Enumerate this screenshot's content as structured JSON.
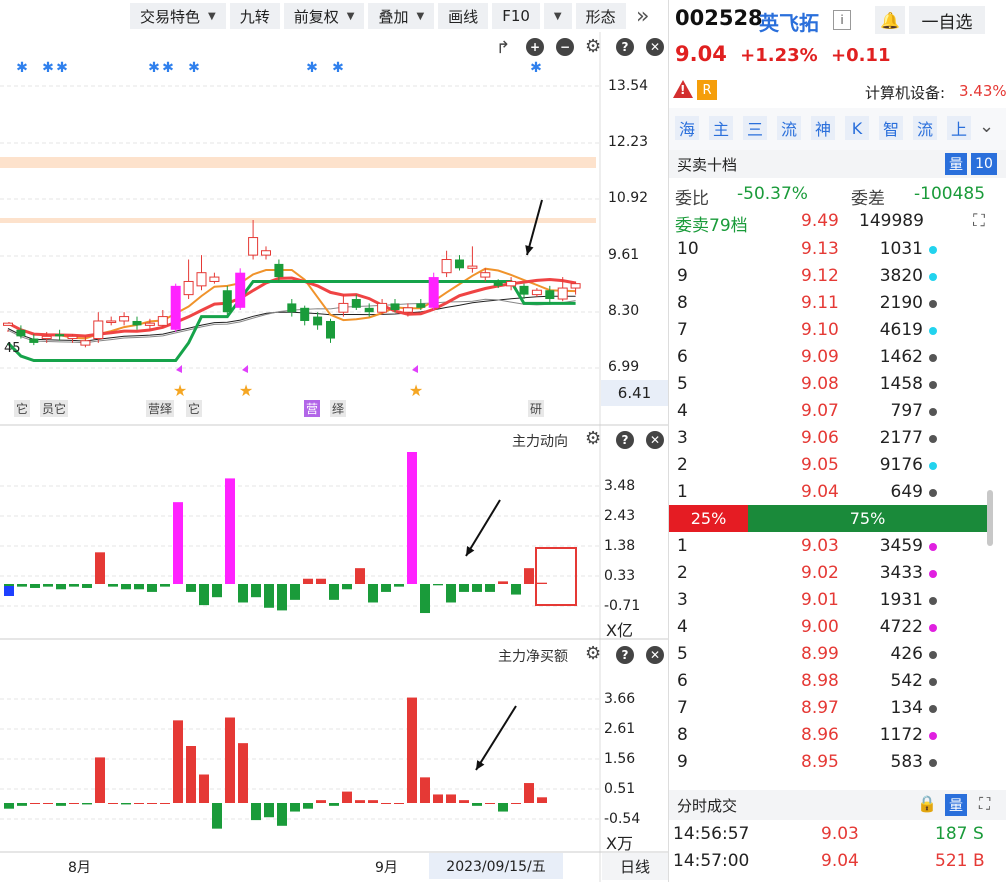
{
  "toolbar": {
    "items": [
      "交易特色",
      "九转",
      "前复权",
      "叠加",
      "画线",
      "F10",
      "",
      "形态"
    ],
    "more_icon": "double-chevron-right-icon"
  },
  "kline": {
    "y_labels": [
      "13.54",
      "12.23",
      "10.92",
      "9.61",
      "8.30",
      "6.99"
    ],
    "last_price_label": "6.41",
    "low_label": "45",
    "tags": [
      "它",
      "员它",
      "营绎",
      "它",
      "营",
      "绎",
      "研"
    ],
    "controls": [
      "rotate-icon",
      "zoom-in-icon",
      "zoom-out-icon",
      "gear-icon",
      "help-icon",
      "close-icon"
    ]
  },
  "flow": {
    "title": "主力动向",
    "y_labels": [
      "3.48",
      "2.43",
      "1.38",
      "0.33",
      "-0.71"
    ],
    "unit": "X亿"
  },
  "netbuy": {
    "title": "主力净买额",
    "y_labels": [
      "3.66",
      "2.61",
      "1.56",
      "0.51",
      "-0.54"
    ],
    "unit": "X万"
  },
  "xaxis": {
    "labels": [
      "8月",
      "9月"
    ],
    "cursor_date": "2023/09/15/五",
    "period": "日线"
  },
  "chart_data": [
    {
      "type": "bar",
      "title": "主力动向",
      "ylim": [
        -0.9,
        4.2
      ],
      "values": [
        -0.2,
        -0.1,
        -0.15,
        -0.1,
        -0.2,
        -0.1,
        -0.15,
        1.2,
        -0.1,
        -0.2,
        -0.2,
        -0.3,
        -0.1,
        3.1,
        -0.3,
        -0.8,
        -0.5,
        4.0,
        -0.7,
        -0.5,
        -0.9,
        -1.0,
        -0.6,
        0.2,
        0.2,
        -0.6,
        -0.2,
        0.6,
        -0.7,
        -0.3,
        -0.1,
        5.0,
        -1.1,
        -0.05,
        -0.7,
        -0.3,
        -0.3,
        -0.3,
        0.1,
        -0.4,
        0.6,
        0.05
      ],
      "colors_note": "magenta bars mark large moves; red positive; green negative"
    },
    {
      "type": "bar",
      "title": "主力净买额",
      "ylim": [
        -0.9,
        4.0
      ],
      "values": [
        -0.2,
        -0.1,
        0.0,
        0.0,
        -0.1,
        0.0,
        -0.05,
        1.6,
        0.0,
        -0.05,
        0.0,
        0.0,
        0.0,
        2.9,
        2.0,
        1.0,
        -0.9,
        3.0,
        2.1,
        -0.6,
        -0.5,
        -0.8,
        -0.3,
        -0.2,
        0.1,
        -0.1,
        0.4,
        0.1,
        0.1,
        0.0,
        0.0,
        3.7,
        0.9,
        0.3,
        0.3,
        0.1,
        -0.1,
        0.0,
        -0.3,
        0.0,
        0.7,
        0.2
      ]
    },
    {
      "type": "candlestick",
      "ylim": [
        6.3,
        14.5
      ],
      "candles": [
        [
          8.0,
          8.05,
          7.9,
          7.85
        ],
        [
          7.9,
          7.75,
          8.0,
          7.7
        ],
        [
          7.7,
          7.6,
          7.8,
          7.55
        ],
        [
          7.7,
          7.75,
          7.85,
          7.6
        ],
        [
          7.8,
          7.75,
          7.9,
          7.65
        ],
        [
          7.7,
          7.75,
          7.8,
          7.6
        ],
        [
          7.55,
          7.65,
          7.75,
          7.5
        ],
        [
          7.7,
          8.1,
          8.3,
          7.6
        ],
        [
          8.1,
          8.1,
          8.2,
          8.0
        ],
        [
          8.1,
          8.2,
          8.3,
          8.0
        ],
        [
          8.1,
          8.0,
          8.2,
          7.9
        ],
        [
          8.0,
          8.05,
          8.15,
          7.9
        ],
        [
          8.0,
          8.2,
          8.35,
          7.95
        ],
        [
          7.9,
          8.9,
          8.95,
          7.85
        ],
        [
          8.7,
          9.0,
          9.5,
          8.6
        ],
        [
          8.9,
          9.2,
          9.6,
          8.8
        ],
        [
          9.0,
          9.1,
          9.2,
          8.95
        ],
        [
          8.8,
          8.3,
          8.9,
          8.25
        ],
        [
          8.4,
          9.2,
          9.3,
          8.35
        ],
        [
          9.6,
          10.0,
          10.4,
          9.5
        ],
        [
          9.6,
          9.7,
          9.8,
          9.5
        ],
        [
          9.4,
          9.1,
          9.5,
          9.0
        ],
        [
          8.5,
          8.3,
          8.6,
          8.2
        ],
        [
          8.4,
          8.1,
          8.45,
          8.0
        ],
        [
          8.2,
          8.0,
          8.3,
          7.9
        ],
        [
          8.1,
          7.7,
          8.15,
          7.6
        ],
        [
          8.3,
          8.5,
          8.7,
          8.2
        ],
        [
          8.6,
          8.4,
          8.7,
          8.35
        ],
        [
          8.4,
          8.3,
          8.5,
          8.2
        ],
        [
          8.3,
          8.5,
          8.6,
          8.25
        ],
        [
          8.5,
          8.35,
          8.6,
          8.3
        ],
        [
          8.3,
          8.4,
          8.5,
          8.2
        ],
        [
          8.5,
          8.4,
          8.6,
          8.35
        ],
        [
          8.4,
          9.1,
          9.2,
          8.35
        ],
        [
          9.2,
          9.5,
          9.7,
          9.1
        ],
        [
          9.5,
          9.3,
          9.6,
          9.25
        ],
        [
          9.3,
          9.35,
          9.8,
          9.2
        ],
        [
          9.1,
          9.2,
          9.3,
          9.0
        ],
        [
          9.0,
          8.9,
          9.05,
          8.85
        ],
        [
          8.9,
          9.0,
          9.1,
          8.8
        ],
        [
          8.9,
          8.7,
          8.95,
          8.6
        ],
        [
          8.7,
          8.8,
          8.85,
          8.65
        ],
        [
          8.8,
          8.6,
          8.9,
          8.5
        ],
        [
          8.6,
          8.85,
          9.1,
          8.55
        ],
        [
          8.85,
          8.95,
          9.0,
          8.7
        ]
      ],
      "ma_lines": [
        {
          "name": "green",
          "values": [
            7.6,
            7.3,
            7.2,
            7.2,
            7.2,
            7.2,
            7.2,
            7.2,
            7.2,
            7.2,
            7.2,
            7.2,
            7.2,
            7.2,
            7.6,
            8.2,
            8.2,
            8.2,
            8.6,
            9.0,
            9.0,
            9.0,
            9.0,
            9.0,
            9.0,
            9.0,
            9.0,
            9.0,
            9.0,
            9.0,
            9.0,
            9.0,
            9.0,
            9.0,
            9.0,
            9.0,
            9.0,
            9.0,
            9.0,
            9.0,
            8.5,
            8.5,
            8.5,
            8.5,
            8.5
          ]
        }
      ]
    }
  ],
  "quote": {
    "code": "002528",
    "name": "英飞拓",
    "info_icon": "info-icon",
    "price": "9.04",
    "change_pct": "+1.23%",
    "change": "+0.11",
    "sector_label": "计算机设备:",
    "sector_change": "3.43%",
    "bell_icon": "bell-icon",
    "watch_label": "一自选",
    "risk_badges": [
      "!",
      "R"
    ]
  },
  "feature_tabs": [
    "海",
    "主",
    "三",
    "流",
    "神",
    "K",
    "智",
    "流",
    "上"
  ],
  "orderbook": {
    "title": "买卖十档",
    "qty_label": "量",
    "depth": "10",
    "weibi_label": "委比",
    "weibi": "-50.37%",
    "weicha_label": "委差",
    "weicha": "-100485",
    "sell_summary_label": "委卖79档",
    "sell_summary_price": "9.49",
    "sell_summary_qty": "149989",
    "asks": [
      {
        "level": "10",
        "price": "9.13",
        "qty": "1031",
        "dot": "#22d3ee"
      },
      {
        "level": "9",
        "price": "9.12",
        "qty": "3820",
        "dot": "#22d3ee"
      },
      {
        "level": "8",
        "price": "9.11",
        "qty": "2190",
        "dot": "#555555"
      },
      {
        "level": "7",
        "price": "9.10",
        "qty": "4619",
        "dot": "#22d3ee"
      },
      {
        "level": "6",
        "price": "9.09",
        "qty": "1462",
        "dot": "#555555"
      },
      {
        "level": "5",
        "price": "9.08",
        "qty": "1458",
        "dot": "#555555"
      },
      {
        "level": "4",
        "price": "9.07",
        "qty": "797",
        "dot": "#555555"
      },
      {
        "level": "3",
        "price": "9.06",
        "qty": "2177",
        "dot": "#555555"
      },
      {
        "level": "2",
        "price": "9.05",
        "qty": "9176",
        "dot": "#22d3ee"
      },
      {
        "level": "1",
        "price": "9.04",
        "qty": "649",
        "dot": "#555555"
      }
    ],
    "ratio_buy": "25%",
    "ratio_sell": "75%",
    "bids": [
      {
        "level": "1",
        "price": "9.03",
        "qty": "3459",
        "dot": "#e020e0"
      },
      {
        "level": "2",
        "price": "9.02",
        "qty": "3433",
        "dot": "#e020e0"
      },
      {
        "level": "3",
        "price": "9.01",
        "qty": "1931",
        "dot": "#555555"
      },
      {
        "level": "4",
        "price": "9.00",
        "qty": "4722",
        "dot": "#e020e0"
      },
      {
        "level": "5",
        "price": "8.99",
        "qty": "426",
        "dot": "#555555"
      },
      {
        "level": "6",
        "price": "8.98",
        "qty": "542",
        "dot": "#555555"
      },
      {
        "level": "7",
        "price": "8.97",
        "qty": "134",
        "dot": "#555555"
      },
      {
        "level": "8",
        "price": "8.96",
        "qty": "1172",
        "dot": "#e020e0"
      },
      {
        "level": "9",
        "price": "8.95",
        "qty": "583",
        "dot": "#555555"
      }
    ]
  },
  "trades": {
    "title": "分时成交",
    "lock_icon": "lock-icon",
    "qty_label": "量",
    "expand_icon": "expand-icon",
    "rows": [
      {
        "time": "14:56:57",
        "price": "9.03",
        "qty": "187",
        "side": "S"
      },
      {
        "time": "14:57:00",
        "price": "9.04",
        "qty": "521",
        "side": "B"
      }
    ]
  },
  "colors": {
    "up": "#e53935",
    "down": "#1a9b3a",
    "magenta": "#ff22ff",
    "accent": "#2a6fdb"
  }
}
